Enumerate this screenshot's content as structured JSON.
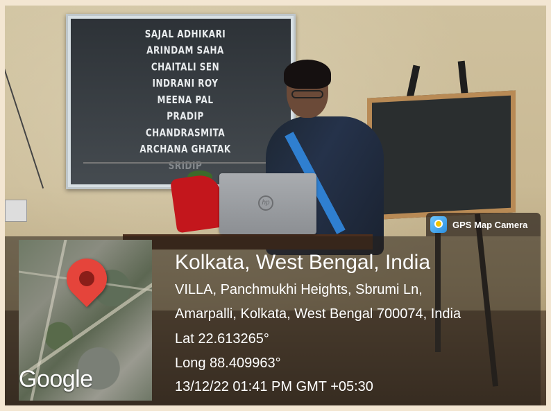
{
  "projection": {
    "credits": [
      "SAJAL ADHIKARI",
      "ARINDAM SAHA",
      "CHAITALI SEN",
      "INDRANI ROY",
      "MEENA PAL",
      "PRADIP",
      "CHANDRASMITA",
      "ARCHANA GHATAK",
      "SRIDIP"
    ]
  },
  "laptop": {
    "logo": "hp"
  },
  "gps": {
    "app_name": "GPS Map Camera",
    "icon": "gps-map-camera-icon",
    "map_brand": "Google",
    "map_pin_icon": "map-pin-icon",
    "location_title": "Kolkata, West Bengal, India",
    "address_line1": "VILLA, Panchmukhi Heights, Sbrumi Ln,",
    "address_line2": "Amarpalli, Kolkata, West Bengal 700074, India",
    "latitude": "Lat 22.613265°",
    "longitude": "Long 88.409963°",
    "datetime": "13/12/22 01:41 PM GMT +05:30"
  },
  "colors": {
    "pin": "#e5443b",
    "overlay": "#28201a",
    "saree_border": "#2f7fd0"
  }
}
